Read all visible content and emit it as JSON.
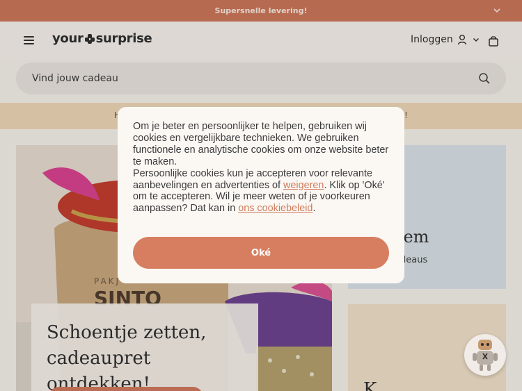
{
  "announcement": {
    "text": "Supersnelle levering!"
  },
  "header": {
    "logo": {
      "left": "your",
      "right": "surprise"
    },
    "login_label": "Inloggen"
  },
  "search": {
    "placeholder": "Vind jouw cadeau"
  },
  "promo": {
    "left_text": "H",
    "right_text": "!"
  },
  "hero": {
    "title_line1": "Schoentje zetten,",
    "title_line2": "cadeaupret ontdekken!",
    "sack_text_top": "PAKJ",
    "sack_text_main": "SINTO"
  },
  "cards": [
    {
      "title": "hem",
      "subtitle": "deaus"
    },
    {
      "title": "K"
    }
  ],
  "cookie_modal": {
    "text_1": "Om je beter en persoonlijker te helpen, gebruiken wij cookies en vergelijkbare technieken. We gebruiken functionele en analytische cookies om onze website beter te maken.",
    "text_2a": "Persoonlijke cookies kun je accepteren voor relevante aanbevelingen en advertenties of ",
    "link_refuse": "weigeren",
    "text_2b": ". Klik op 'Oké' om te accepteren. Wil je meer weten of je voorkeuren aanpassen? Dat kan in ",
    "link_policy": "ons cookiebeleid",
    "text_2c": ".",
    "accept_label": "Oké"
  },
  "colors": {
    "brand": "#ca7557",
    "accept_button": "#d77e60",
    "promo_bar": "#edd5b4"
  },
  "icons": [
    "chevron-down-icon",
    "menu-icon",
    "user-icon",
    "bag-icon",
    "search-icon",
    "chat-robot-icon"
  ]
}
